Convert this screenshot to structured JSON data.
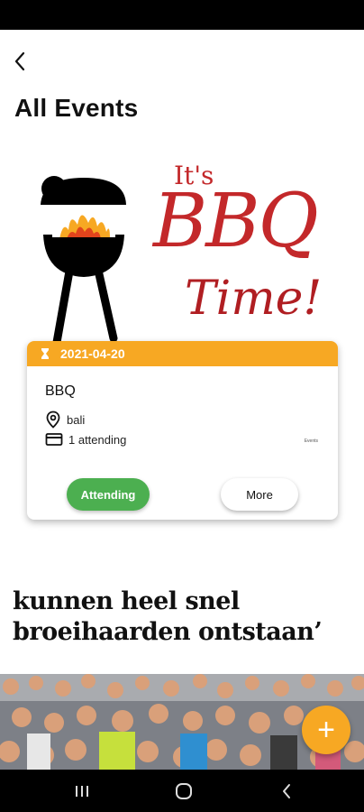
{
  "header": {
    "title": "All Events"
  },
  "promo": {
    "line1": "It's",
    "line2": "BBQ",
    "line3": "Time!"
  },
  "event_card": {
    "date": "2021-04-20",
    "name": "BBQ",
    "location": "bali",
    "attending_count": "1 attending",
    "tiny_label": "Events",
    "attending_button": "Attending",
    "more_button": "More",
    "accent_color": "#f7a823",
    "attending_color": "#4caf50"
  },
  "news": {
    "headline": "kunnen heel snel broeihaarden ontstaan’"
  },
  "fab": {
    "label": "+"
  },
  "icons": [
    "back-arrow-icon",
    "hourglass-icon",
    "location-pin-icon",
    "ticket-card-icon",
    "plus-icon",
    "recents-icon",
    "home-icon",
    "back-nav-icon"
  ]
}
